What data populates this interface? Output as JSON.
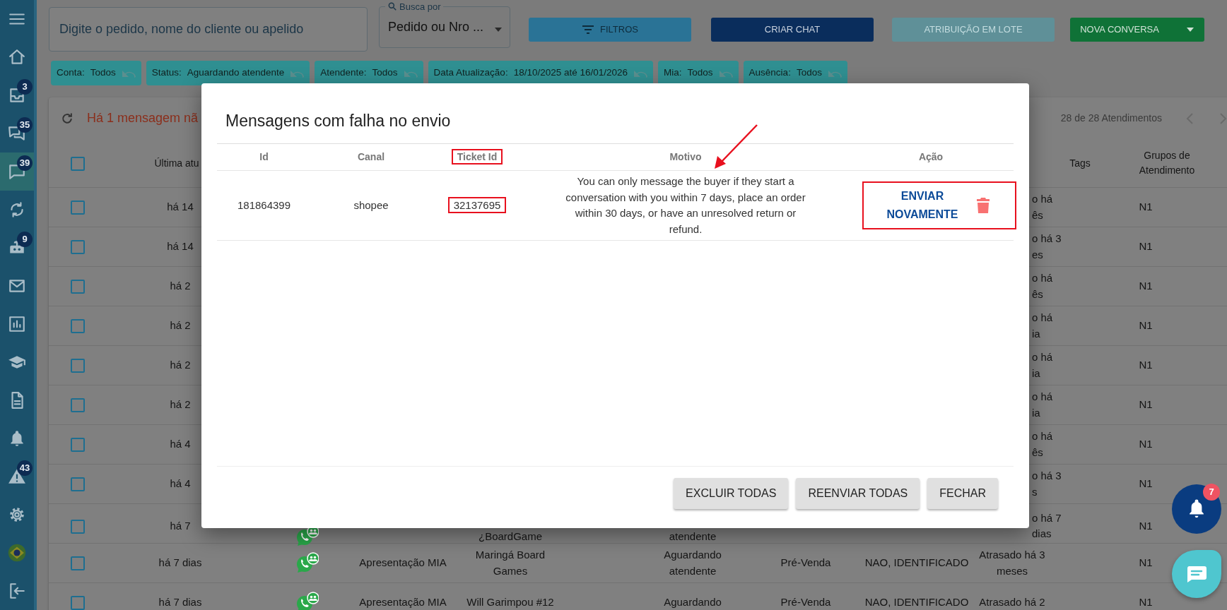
{
  "sidebar": {
    "items": [
      {
        "selected": false
      },
      {
        "badge": "3",
        "selected": false
      },
      {
        "badge": "35",
        "selected": false
      },
      {
        "badge": "39",
        "selected": true
      },
      {
        "selected": false
      },
      {
        "badge": "9",
        "selected": false
      },
      {
        "selected": false
      },
      {
        "selected": false
      },
      {
        "selected": false
      },
      {
        "selected": false
      },
      {
        "selected": false
      },
      {
        "badge": "43",
        "selected": false
      },
      {
        "selected": false
      }
    ]
  },
  "search": {
    "placeholder": "Digite o pedido, nome do cliente ou apelido"
  },
  "search_type": {
    "label": "Busca por",
    "value": "Pedido ou Nro ..."
  },
  "toolbar_buttons": [
    {
      "label": "FILTROS",
      "kind": "filter",
      "disabled": false
    },
    {
      "label": "CRIAR CHAT",
      "kind": "primary",
      "disabled": false
    },
    {
      "label": "ATRIBUIÇÃO EM LOTE",
      "kind": "secondary",
      "disabled": true
    },
    {
      "label": "NOVA CONVERSA",
      "kind": "split",
      "disabled": false
    }
  ],
  "filters": [
    {
      "label": "Conta:",
      "value": "Todos"
    },
    {
      "label": "Status:",
      "value": "Aguardando atendente"
    },
    {
      "label": "Atendente:",
      "value": "Todos"
    },
    {
      "label": "Data Atualização:",
      "value": "18/10/2025 até 16/01/2026"
    },
    {
      "label": "Mia:",
      "value": "Todos"
    },
    {
      "label": "Ausência:",
      "value": "Todos"
    }
  ],
  "table": {
    "notice": "Há 1 mensagem nã",
    "count": "28 de 28 Atendimentos",
    "select_all_checked": false,
    "columns": [
      "Última atu",
      "Tags",
      "Grupos de\nAtendimento"
    ],
    "rows": [
      {
        "kind": "covered",
        "checked": false,
        "updated": "há 14",
        "delay": "o há\nês",
        "group": "N1"
      },
      {
        "kind": "covered",
        "checked": false,
        "updated": "há 14",
        "delay": "o há 3\nes",
        "group": "N1"
      },
      {
        "kind": "covered",
        "checked": false,
        "updated": "há 2",
        "delay": "o há\nês",
        "group": "N1"
      },
      {
        "kind": "covered",
        "checked": false,
        "updated": "há 2",
        "delay": "o há\nia",
        "group": "N1"
      },
      {
        "kind": "covered",
        "checked": false,
        "updated": "há 2",
        "delay": "o há\nia",
        "group": "N1"
      },
      {
        "kind": "covered",
        "checked": false,
        "updated": "há 2",
        "delay": "o há\nia",
        "group": "N1"
      },
      {
        "kind": "covered",
        "checked": false,
        "updated": "há 4",
        "delay": "o há\nês",
        "group": "N1"
      },
      {
        "kind": "covered",
        "checked": false,
        "updated": "há 4",
        "delay": "o há 3\ns",
        "group": "N1"
      },
      {
        "kind": "partial",
        "checked": false,
        "updated": "há 7",
        "client": "¿BoardGame",
        "status": "atendente",
        "delay": "o há 7\ndias",
        "group": "N1"
      },
      {
        "kind": "full",
        "checked": false,
        "updated": "há 7 dias",
        "account": "Apresentação MIA",
        "client": "Maringá Board\nGames",
        "status": "Aguardando\natendente",
        "stage": "Pré-Venda",
        "identified": "NAO, IDENTIFICADO",
        "delay": "Atrasado há 3\nmeses",
        "group": "N1"
      },
      {
        "kind": "full",
        "checked": false,
        "updated": "há 7 dias",
        "account": "Apresentação MIA",
        "client": "Will Garimpou #12",
        "status": "Aguardando",
        "stage": "Pré-Venda",
        "identified": "NAO, IDENTIFICADO",
        "delay": "Atrasado há 2",
        "group": "N1"
      }
    ]
  },
  "dialog": {
    "title": "Mensagens com falha no envio",
    "annotation_arrow": true,
    "columns": [
      {
        "label": "Id",
        "highlighted": false
      },
      {
        "label": "Canal",
        "highlighted": false
      },
      {
        "label": "Ticket Id",
        "highlighted": true
      },
      {
        "label": "Motivo",
        "highlighted": false
      },
      {
        "label": "Ação",
        "highlighted": false
      }
    ],
    "rows": [
      {
        "id": "181864399",
        "channel": "shopee",
        "ticket_id": "32137695",
        "ticket_highlighted": true,
        "reason": "You can only message the buyer if they start a conversation with you within 7 days, place an order within 30 days, or have an unresolved return or refund.",
        "action": "ENVIAR NOVAMENTE",
        "action_highlighted": true
      }
    ],
    "buttons": [
      "EXCLUIR TODAS",
      "REENVIAR TODAS",
      "FECHAR"
    ]
  },
  "notifications": {
    "badge": "7"
  }
}
